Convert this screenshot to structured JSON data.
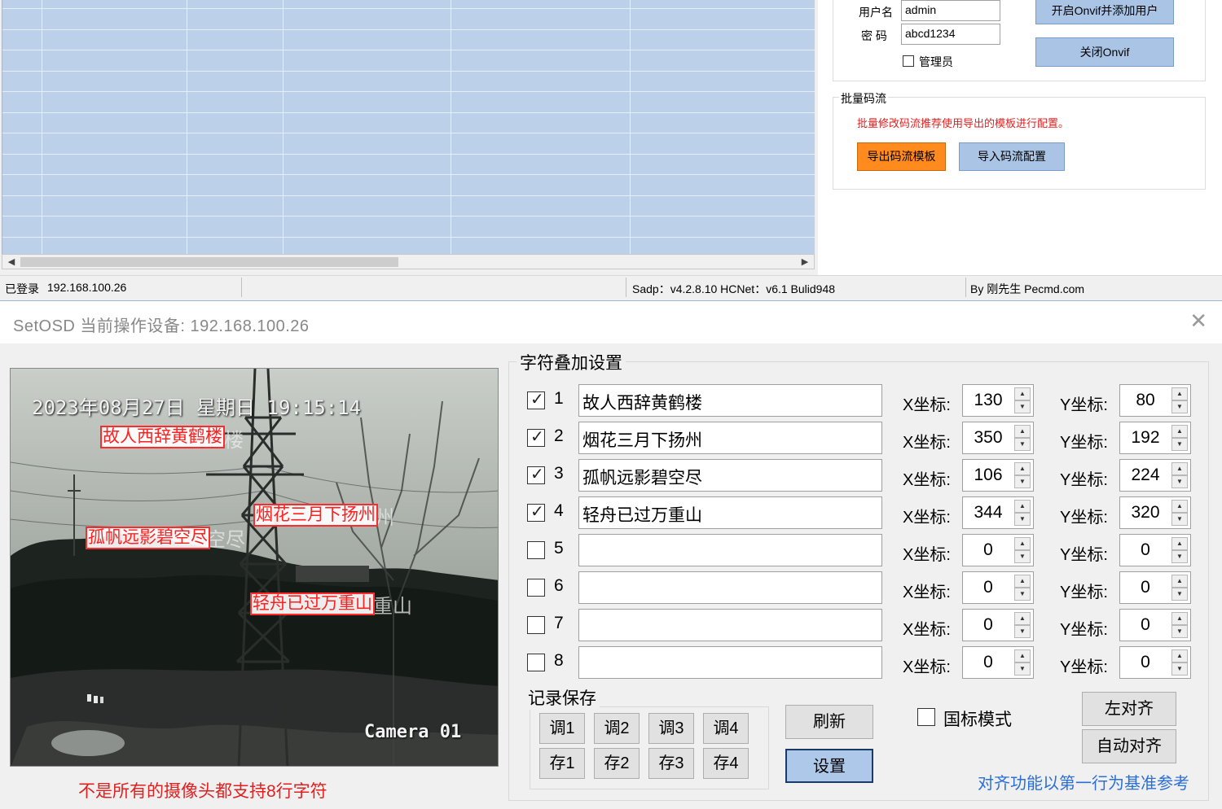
{
  "main": {
    "onvif": {
      "username_label": "用户名",
      "username_value": "admin",
      "password_label": "密 码",
      "password_value": "abcd1234",
      "admin_label": "管理员",
      "enable_button": "开启Onvif并添加用户",
      "close_button": "关闭Onvif"
    },
    "batch": {
      "title": "批量码流",
      "note": "批量修改码流推荐使用导出的模板进行配置。",
      "export_button": "导出码流模板",
      "import_button": "导入码流配置"
    },
    "status": {
      "login": "已登录",
      "ip": "192.168.100.26",
      "version": "Sadp：v4.2.8.10  HCNet：v6.1  Bulid948",
      "author": "By 刚先生 Pecmd.com"
    },
    "scroll_left_icon": "◀",
    "scroll_right_icon": "▶"
  },
  "dialog": {
    "title": "SetOSD  当前操作设备: 192.168.100.26",
    "close_icon": "✕",
    "preview": {
      "timestamp": "2023年08月27日  星期日  19:15:14",
      "camera_name": "Camera  01",
      "overlays": [
        "故人西辞黄鹤楼",
        "烟花三月下扬州",
        "孤帆远影碧空尽",
        "轻舟已过万重山"
      ]
    },
    "warning": "不是所有的摄像头都支持8行字符",
    "osd_group_title": "字符叠加设置",
    "x_label": "X坐标:",
    "y_label": "Y坐标:",
    "rows": [
      {
        "num": "1",
        "checked": true,
        "text": "故人西辞黄鹤楼",
        "x": "130",
        "y": "80"
      },
      {
        "num": "2",
        "checked": true,
        "text": "烟花三月下扬州",
        "x": "350",
        "y": "192"
      },
      {
        "num": "3",
        "checked": true,
        "text": "孤帆远影碧空尽",
        "x": "106",
        "y": "224"
      },
      {
        "num": "4",
        "checked": true,
        "text": "轻舟已过万重山",
        "x": "344",
        "y": "320"
      },
      {
        "num": "5",
        "checked": false,
        "text": "",
        "x": "0",
        "y": "0"
      },
      {
        "num": "6",
        "checked": false,
        "text": "",
        "x": "0",
        "y": "0"
      },
      {
        "num": "7",
        "checked": false,
        "text": "",
        "x": "0",
        "y": "0"
      },
      {
        "num": "8",
        "checked": false,
        "text": "",
        "x": "0",
        "y": "0"
      }
    ],
    "record": {
      "title": "记录保存",
      "load_buttons": [
        "调1",
        "调2",
        "调3",
        "调4"
      ],
      "save_buttons": [
        "存1",
        "存2",
        "存3",
        "存4"
      ]
    },
    "refresh_button": "刷新",
    "set_button": "设置",
    "national_mode_label": "国标模式",
    "left_align_button": "左对齐",
    "auto_align_button": "自动对齐",
    "align_note": "对齐功能以第一行为基准参考",
    "check_icon": "✓",
    "spin_up_icon": "▲",
    "spin_down_icon": "▼"
  }
}
